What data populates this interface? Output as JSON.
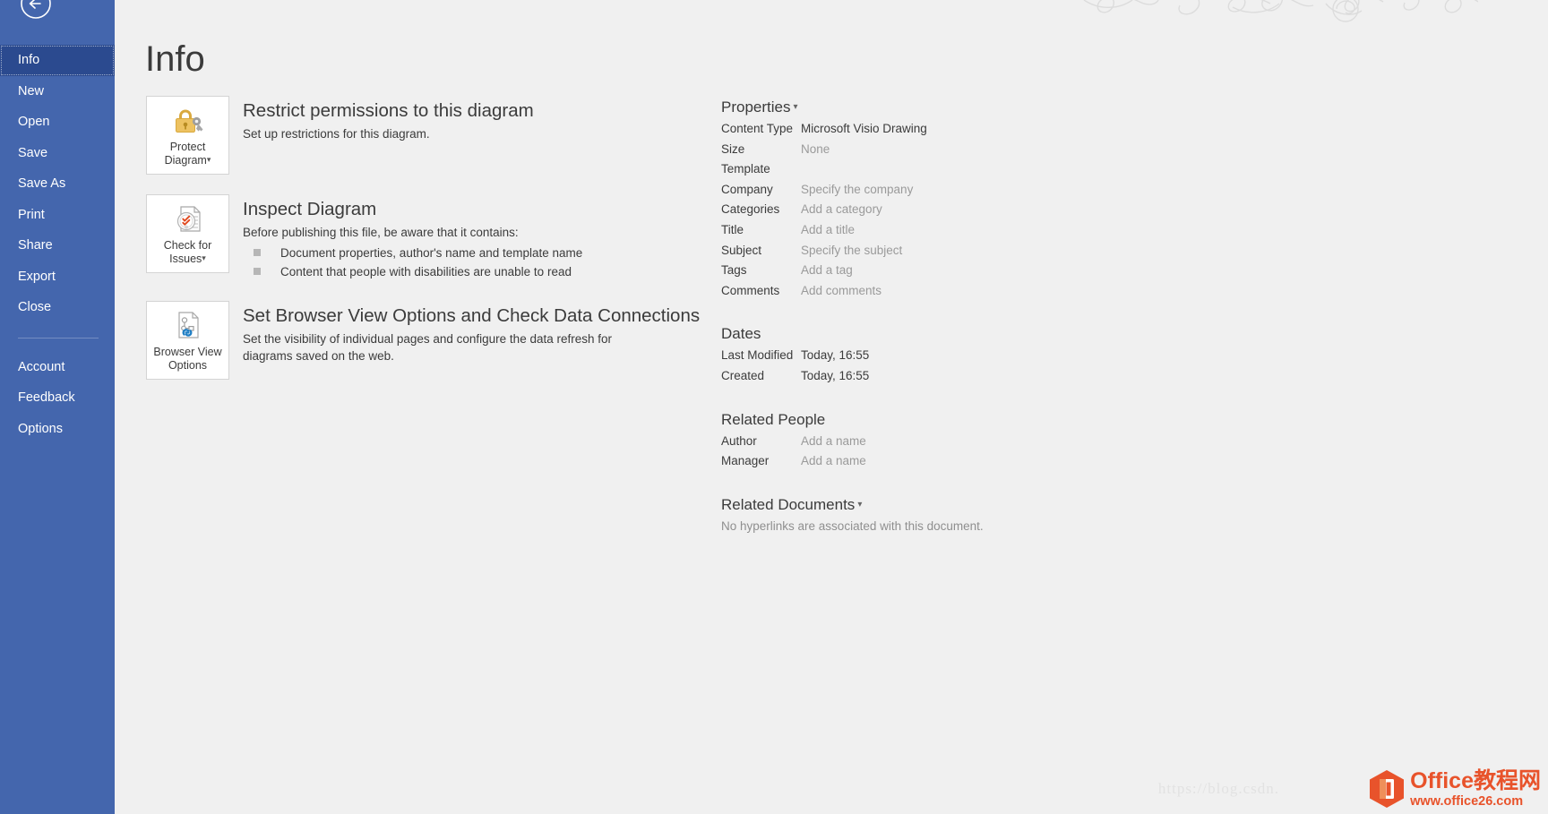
{
  "sidebar": {
    "back_icon": "back-arrow-icon",
    "items": [
      {
        "label": "Info",
        "active": true
      },
      {
        "label": "New",
        "active": false
      },
      {
        "label": "Open",
        "active": false
      },
      {
        "label": "Save",
        "active": false
      },
      {
        "label": "Save As",
        "active": false
      },
      {
        "label": "Print",
        "active": false
      },
      {
        "label": "Share",
        "active": false
      },
      {
        "label": "Export",
        "active": false
      },
      {
        "label": "Close",
        "active": false
      }
    ],
    "items_bottom": [
      {
        "label": "Account"
      },
      {
        "label": "Feedback"
      },
      {
        "label": "Options"
      }
    ]
  },
  "page": {
    "title": "Info"
  },
  "actions": {
    "protect": {
      "tile_label_line1": "Protect",
      "tile_label_line2": "Diagram",
      "tile_caret": "▾",
      "icon": "padlock-key-icon",
      "title": "Restrict permissions to this diagram",
      "desc": "Set up restrictions for this diagram."
    },
    "inspect": {
      "tile_label_line1": "Check for",
      "tile_label_line2": "Issues",
      "tile_caret": "▾",
      "icon": "document-inspect-icon",
      "title": "Inspect Diagram",
      "desc": "Before publishing this file, be aware that it contains:",
      "bullets": [
        "Document properties, author's name and template name",
        "Content that people with disabilities are unable to read"
      ]
    },
    "browser_view": {
      "tile_label_line1": "Browser View",
      "tile_label_line2": "Options",
      "icon": "document-link-icon",
      "title": "Set Browser View Options and Check Data Connections",
      "desc": "Set the visibility of individual pages and configure the data refresh for diagrams saved on the web."
    }
  },
  "properties": {
    "heading": "Properties",
    "caret": "▾",
    "rows": [
      {
        "key": "Content Type",
        "value": "Microsoft Visio Drawing",
        "placeholder": false
      },
      {
        "key": "Size",
        "value": "None",
        "placeholder": true
      },
      {
        "key": "Template",
        "value": "",
        "placeholder": false
      },
      {
        "key": "Company",
        "value": "Specify the company",
        "placeholder": true
      },
      {
        "key": "Categories",
        "value": "Add a category",
        "placeholder": true
      },
      {
        "key": "Title",
        "value": "Add a title",
        "placeholder": true
      },
      {
        "key": "Subject",
        "value": "Specify the subject",
        "placeholder": true
      },
      {
        "key": "Tags",
        "value": "Add a tag",
        "placeholder": true
      },
      {
        "key": "Comments",
        "value": "Add comments",
        "placeholder": true
      }
    ]
  },
  "dates": {
    "heading": "Dates",
    "rows": [
      {
        "key": "Last Modified",
        "value": "Today, 16:55"
      },
      {
        "key": "Created",
        "value": "Today, 16:55"
      }
    ]
  },
  "related_people": {
    "heading": "Related People",
    "rows": [
      {
        "key": "Author",
        "value": "Add a name"
      },
      {
        "key": "Manager",
        "value": "Add a name"
      }
    ]
  },
  "related_documents": {
    "heading": "Related Documents",
    "caret": "▾",
    "note": "No hyperlinks are associated with this document."
  },
  "watermark": {
    "url_text": "https://blog.csdn.",
    "logo_main": "Office教程网",
    "logo_sub": "www.office26.com",
    "logo_icon": "office-hex-icon"
  },
  "colors": {
    "sidebar_bg": "#4466ad",
    "sidebar_active": "#2b4a8f",
    "canvas_bg": "#f0f0f0",
    "text": "#3b3b3b",
    "placeholder": "#9a9a9a",
    "logo_orange": "#e8532b",
    "lock_gold": "#e8bd55"
  }
}
